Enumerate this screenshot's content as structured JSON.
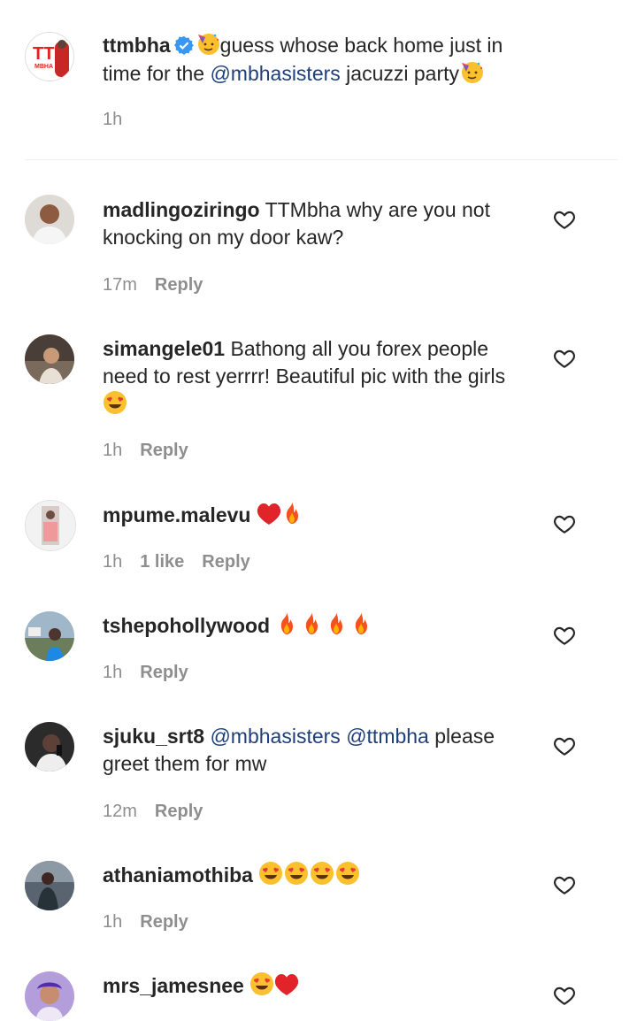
{
  "caption": {
    "username": "ttmbha",
    "text_a": "guess whose back home just in time for the ",
    "mention": "@mbhasisters",
    "text_b": " jacuzzi party",
    "time": "1h",
    "avatar_logo": "TT MBHA"
  },
  "comments": [
    {
      "username": "madlingoziringo",
      "text": " TTMbha why are you not knocking on my door kaw?",
      "time": "17m",
      "reply": "Reply"
    },
    {
      "username": "simangele01",
      "text": " Bathong all you forex people need to rest yerrrr! Beautiful pic with the girls ",
      "time": "1h",
      "reply": "Reply"
    },
    {
      "username": "mpume.malevu",
      "text": " ",
      "time": "1h",
      "likes": "1 like",
      "reply": "Reply"
    },
    {
      "username": "tshepohollywood",
      "text": " ",
      "time": "1h",
      "reply": "Reply"
    },
    {
      "username": "sjuku_srt8",
      "text": " ",
      "mention1": "@mbhasisters",
      "mention2": "@ttmbha",
      "text_after": " please greet them for mw",
      "time": "12m",
      "reply": "Reply"
    },
    {
      "username": "athaniamothiba",
      "text": " ",
      "time": "1h",
      "reply": "Reply"
    },
    {
      "username": "mrs_jamesnee",
      "text": " "
    }
  ],
  "icons": {
    "like": "heart-outline-icon",
    "verified": "verified-badge-icon",
    "party": "party-face-emoji",
    "heart_eyes": "heart-eyes-emoji",
    "fire": "fire-emoji",
    "red_heart": "red-heart-emoji"
  },
  "colors": {
    "text": "#262626",
    "meta": "#8e8e8e",
    "mention": "#1e3f7a",
    "verified": "#3897f0"
  }
}
